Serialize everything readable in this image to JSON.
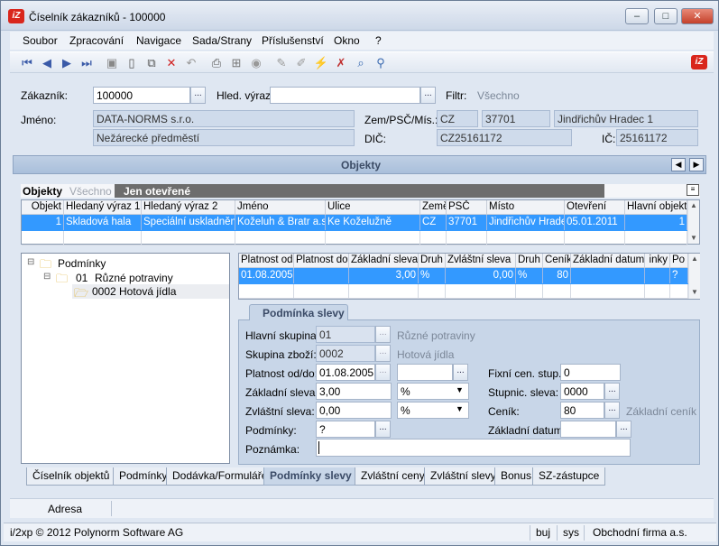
{
  "window": {
    "title": "Číselník zákazníků - 100000",
    "logo": "iZ"
  },
  "menu": [
    "Soubor",
    "Zpracování",
    "Navigace",
    "Sada/Strany",
    "Příslušenství",
    "Okno",
    "?"
  ],
  "form": {
    "zakaznik_label": "Zákazník:",
    "zakaznik": "100000",
    "hled_label": "Hled. výraz:",
    "hled": "",
    "filtr_label": "Filtr:",
    "filtr": "Všechno",
    "jmeno_label": "Jméno:",
    "jmeno1": "DATA-NORMS s.r.o.",
    "jmeno2": "Nežárecké předměstí",
    "zem_label": "Zem/PSČ/Mís.:",
    "zem": "CZ",
    "psc": "37701",
    "misto": "Jindřichův Hradec 1",
    "dic_label": "DIČ:",
    "dic": "CZ25161172",
    "ic_label": "IČ:",
    "ic": "25161172"
  },
  "objekty": {
    "header": "Objekty",
    "filter_title": "Objekty",
    "filter_all": "Všechno",
    "filter_open": "Jen otevřené",
    "columns": [
      "Objekt",
      "Hledaný výraz 1",
      "Hledaný výraz 2",
      "Jméno",
      "Ulice",
      "Země",
      "PSČ",
      "Místo",
      "Otevření",
      "Hlavní objekt"
    ],
    "rows": [
      [
        "1",
        "Skladová hala",
        "Speciální uskladnění",
        "Koželuh & Bratr a.s.",
        "Ke Koželužně",
        "CZ",
        "37701",
        "Jindřichův Hrade",
        "05.01.2011",
        "1"
      ]
    ]
  },
  "tree": {
    "root": "Podmínky",
    "child": "01",
    "child_label": "Různé potraviny",
    "leaf": "0002",
    "leaf_label": "Hotová jídla"
  },
  "cond_grid": {
    "columns": [
      "Platnost od",
      "Platnost do",
      "Základní sleva",
      "Druh",
      "Zvláštní sleva",
      "Druh",
      "Ceník",
      "Základní datum",
      "inky",
      "Po"
    ],
    "rows": [
      [
        "01.08.2005",
        "",
        "3,00",
        "%",
        "0,00",
        "%",
        "80",
        "",
        "",
        "?"
      ]
    ]
  },
  "detail": {
    "tab": "Podmínka slevy",
    "hlavni_label": "Hlavní skupina:",
    "hlavni": "01",
    "hlavni_desc": "Různé potraviny",
    "skupina_label": "Skupina zboží:",
    "skupina": "0002",
    "skupina_desc": "Hotová jídla",
    "platnost_label": "Platnost od/do:",
    "platnost_od": "01.08.2005",
    "platnost_do": "",
    "zakl_label": "Základní sleva:",
    "zakl": "3,00",
    "zakl_druh": "%",
    "zvl_label": "Zvláštní sleva:",
    "zvl": "0,00",
    "zvl_druh": "%",
    "podm_label": "Podmínky:",
    "podm": "?",
    "pozn_label": "Poznámka:",
    "pozn": "",
    "fixni_label": "Fixní cen. stup.:",
    "fixni": "0",
    "stupnic_label": "Stupnic. sleva:",
    "stupnic": "0000",
    "cenik_label": "Ceník:",
    "cenik": "80",
    "cenik_desc": "Základní ceník M",
    "zakl_datum_label": "Základní datum:",
    "zakl_datum": ""
  },
  "bottom_tabs": [
    "Číselník objektů",
    "Podmínky",
    "Dodávka/Formuláře",
    "Podmínky slevy",
    "Zvláštní ceny",
    "Zvláštní slevy",
    "Bonus",
    "SZ-zástupce"
  ],
  "adresa": "Adresa",
  "status": {
    "copyright": "i/2xp © 2012 Polynorm Software AG",
    "user": "buj",
    "db": "sys",
    "firm": "Obchodní firma a.s."
  },
  "colors": {
    "selection": "#3399ff",
    "header": "#b3c6df",
    "accent": "#d9261c"
  }
}
